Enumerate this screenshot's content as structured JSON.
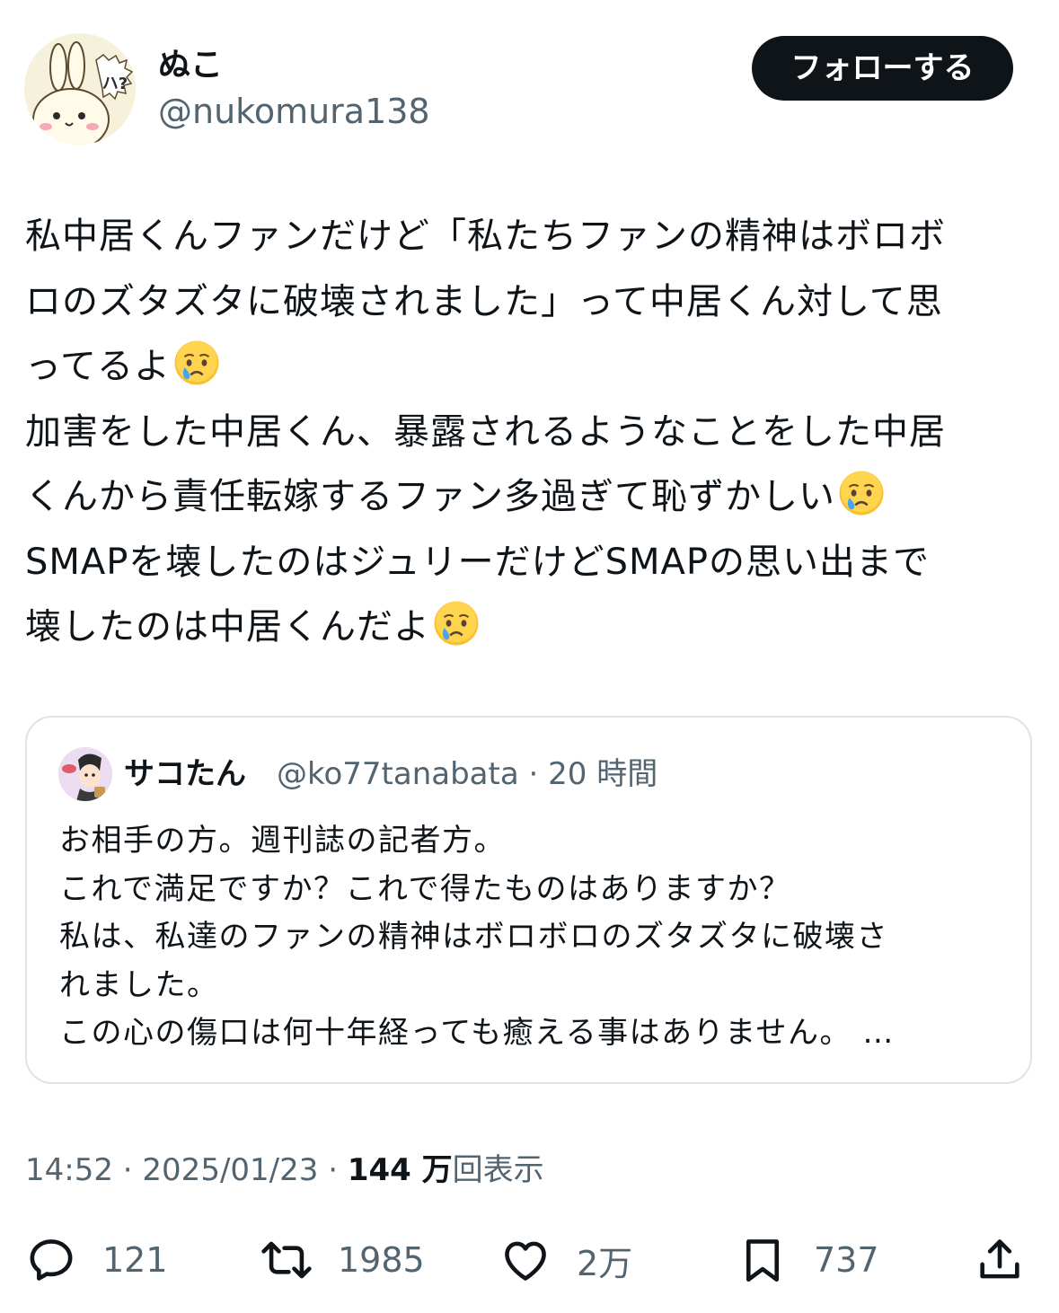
{
  "author": {
    "display_name": "ぬこ",
    "handle": "@nukomura138",
    "avatar_icon": "rabbit-character-icon",
    "avatar_text": "ハ?"
  },
  "follow_button": {
    "label": "フォローする"
  },
  "tweet": {
    "lines": [
      "私中居くんファンだけど「私たちファンの精神はボロボ",
      "ロのズタズタに破壊されました」って中居くん対して思",
      "ってるよ",
      "加害をした中居くん、暴露されるようなことをした中居",
      "くんから責任転嫁するファン多過ぎて恥ずかしい",
      "SMAPを壊したのはジュリーだけどSMAPの思い出まで",
      "壊したのは中居くんだよ"
    ],
    "emoji": "crying-face-emoji"
  },
  "quoted_tweet": {
    "display_name": "サコたん",
    "handle": "@ko77tanabata",
    "separator": "·",
    "time_ago": "20 時間",
    "lines": [
      "お相手の方。週刊誌の記者方。",
      "これで満足ですか？これで得たものはありますか？",
      "私は、私達のファンの精神はボロボロのズタズタに破壊さ",
      "れました。",
      "この心の傷口は何十年経っても癒える事はありません。 …"
    ]
  },
  "meta": {
    "time": "14:52",
    "separator": "·",
    "date": "2025/01/23",
    "views_count": "144 万",
    "views_label": "回表示"
  },
  "actions": {
    "reply_count": "121",
    "retweet_count": "1985",
    "like_count": "2万",
    "bookmark_count": "737"
  },
  "colors": {
    "text": "#0f1419",
    "secondary": "#536471",
    "button_bg": "#0f1419",
    "border": "#dfe3e6"
  }
}
